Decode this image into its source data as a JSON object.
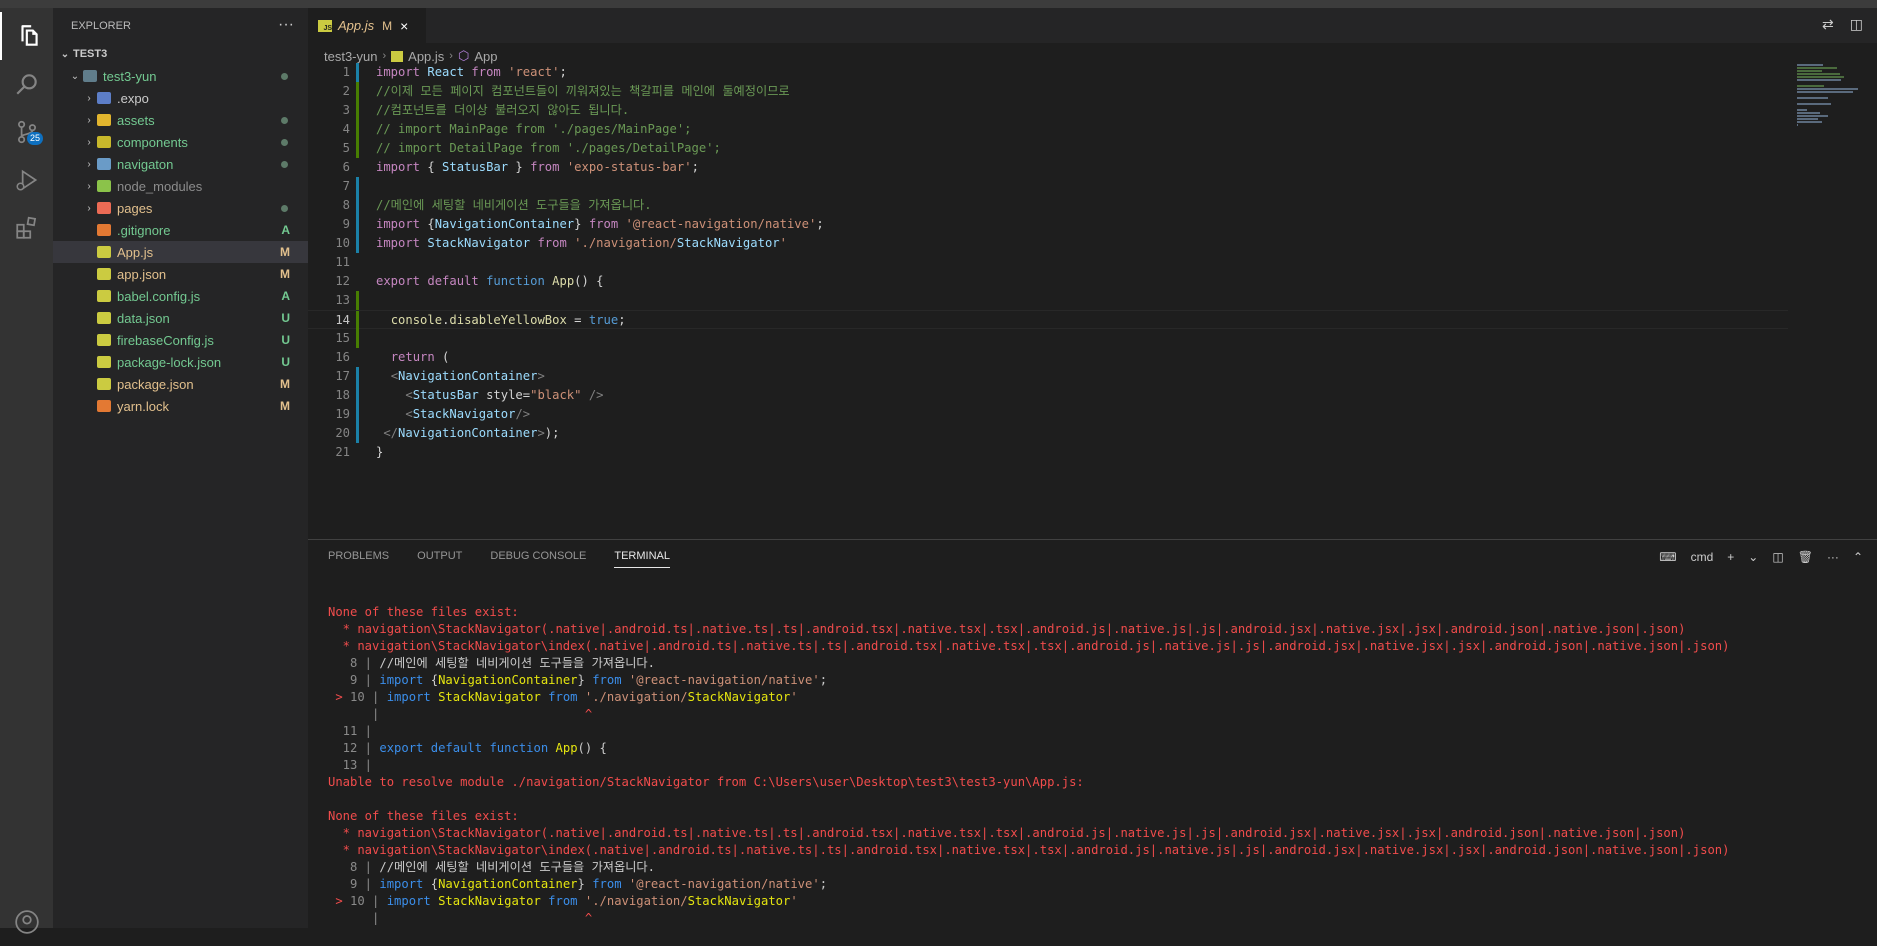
{
  "explorer": {
    "title": "EXPLORER",
    "workspace": "TEST3",
    "items": [
      {
        "label": ".expo",
        "type": "folder",
        "indent": 2,
        "status": "",
        "color": "#cccccc"
      },
      {
        "label": "assets",
        "type": "folder",
        "indent": 2,
        "status": "",
        "color": "#73c991"
      },
      {
        "label": "components",
        "type": "folder",
        "indent": 2,
        "status": "",
        "color": "#73c991"
      },
      {
        "label": "navigaton",
        "type": "folder",
        "indent": 2,
        "status": "",
        "color": "#73c991"
      },
      {
        "label": "node_modules",
        "type": "folder",
        "indent": 2,
        "status": "",
        "color": "#8c8c8c"
      },
      {
        "label": "pages",
        "type": "folder",
        "indent": 2,
        "status": "",
        "color": "#e2c08d"
      },
      {
        "label": ".gitignore",
        "type": "file",
        "indent": 2,
        "status": "A",
        "color": "#73c991"
      },
      {
        "label": "App.js",
        "type": "file",
        "indent": 2,
        "status": "M",
        "color": "#e2c08d"
      },
      {
        "label": "app.json",
        "type": "file",
        "indent": 2,
        "status": "M",
        "color": "#e2c08d"
      },
      {
        "label": "babel.config.js",
        "type": "file",
        "indent": 2,
        "status": "A",
        "color": "#73c991"
      },
      {
        "label": "data.json",
        "type": "file",
        "indent": 2,
        "status": "U",
        "color": "#73c991"
      },
      {
        "label": "firebaseConfig.js",
        "type": "file",
        "indent": 2,
        "status": "U",
        "color": "#73c991"
      },
      {
        "label": "package-lock.json",
        "type": "file",
        "indent": 2,
        "status": "U",
        "color": "#73c991"
      },
      {
        "label": "package.json",
        "type": "file",
        "indent": 2,
        "status": "M",
        "color": "#e2c08d"
      },
      {
        "label": "yarn.lock",
        "type": "file",
        "indent": 2,
        "status": "M",
        "color": "#e2c08d"
      }
    ],
    "folder_label": "test3-yun"
  },
  "activity": {
    "scm_badge": "25"
  },
  "tab": {
    "name": "App.js",
    "modified": "M",
    "close": "×"
  },
  "breadcrumb": {
    "folder": "test3-yun",
    "file": "App.js",
    "symbol": "App"
  },
  "code_lines": [
    "import React from 'react';",
    "//이제 모든 페이지 컴포넌트들이 끼워져있는 책갈피를 메인에 둘예정이므로",
    "//컴포넌트를 더이상 불러오지 않아도 됩니다.",
    "// import MainPage from './pages/MainPage';",
    "// import DetailPage from './pages/DetailPage';",
    "import { StatusBar } from 'expo-status-bar';",
    "",
    "//메인에 세팅할 네비게이션 도구들을 가져옵니다.",
    "import {NavigationContainer} from '@react-navigation/native';",
    "import StackNavigator from './navigation/StackNavigator'",
    "",
    "export default function App() {",
    "",
    "  console.disableYellowBox = true;",
    "",
    "  return (",
    "  <NavigationContainer>",
    "    <StatusBar style=\"black\" />",
    "    <StackNavigator/>",
    " </NavigationContainer>);",
    "}"
  ],
  "panel": {
    "tabs": [
      "PROBLEMS",
      "OUTPUT",
      "DEBUG CONSOLE",
      "TERMINAL"
    ],
    "active_tab": "TERMINAL",
    "shell": "cmd"
  },
  "terminal_lines": [
    "None of these files exist:",
    "  * navigation\\StackNavigator(.native|.android.ts|.native.ts|.ts|.android.tsx|.native.tsx|.tsx|.android.js|.native.js|.js|.android.jsx|.native.jsx|.jsx|.android.json|.native.json|.json)",
    "  * navigation\\StackNavigator\\index(.native|.android.ts|.native.ts|.ts|.android.tsx|.native.tsx|.tsx|.android.js|.native.js|.js|.android.jsx|.native.jsx|.jsx|.android.json|.native.json|.json)",
    "   8 | //메인에 세팅할 네비게이션 도구들을 가져옵니다.",
    "   9 | import {NavigationContainer} from '@react-navigation/native';",
    " > 10 | import StackNavigator from './navigation/StackNavigator'",
    "      |                            ^",
    "  11 |",
    "  12 | export default function App() {",
    "  13 |",
    "Unable to resolve module ./navigation/StackNavigator from C:\\Users\\user\\Desktop\\test3\\test3-yun\\App.js:",
    "",
    "None of these files exist:",
    "  * navigation\\StackNavigator(.native|.android.ts|.native.ts|.ts|.android.tsx|.native.tsx|.tsx|.android.js|.native.js|.js|.android.jsx|.native.jsx|.jsx|.android.json|.native.json|.json)",
    "  * navigation\\StackNavigator\\index(.native|.android.ts|.native.ts|.ts|.android.tsx|.native.tsx|.tsx|.android.js|.native.js|.js|.android.jsx|.native.jsx|.jsx|.android.json|.native.json|.json)",
    "   8 | //메인에 세팅할 네비게이션 도구들을 가져옵니다.",
    "   9 | import {NavigationContainer} from '@react-navigation/native';",
    " > 10 | import StackNavigator from './navigation/StackNavigator'",
    "      |                            ^"
  ]
}
